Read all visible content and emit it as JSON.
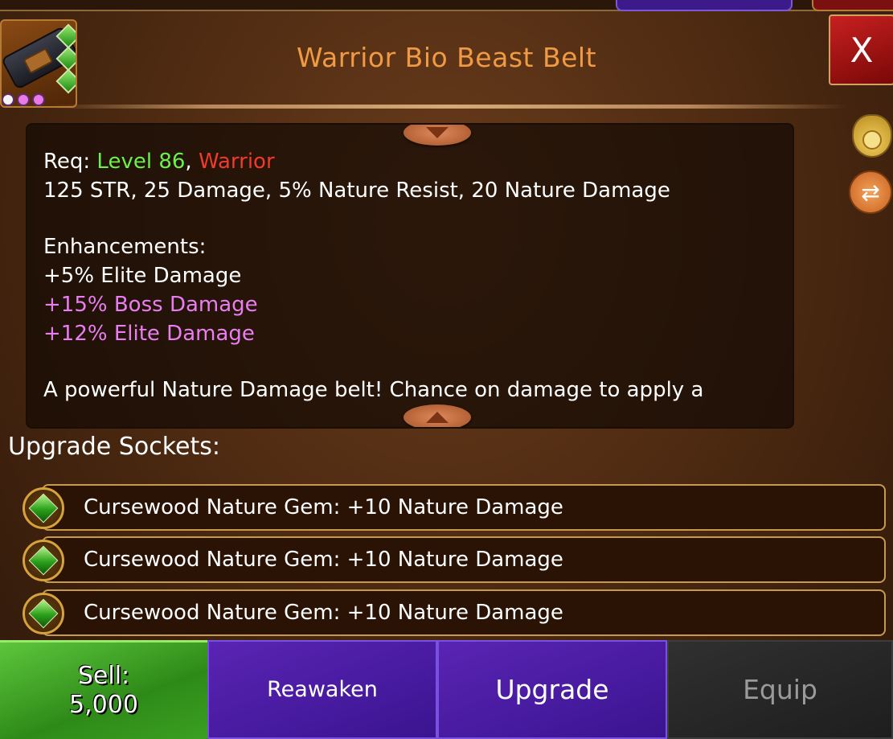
{
  "title": "Warrior Bio Beast Belt",
  "close_label": "X",
  "description": {
    "req_label": "Req: ",
    "req_level": "Level 86",
    "req_separator": ", ",
    "req_class": "Warrior",
    "stats": "125 STR, 25 Damage, 5% Nature Resist, 20 Nature Damage",
    "enhancements_label": "Enhancements:",
    "enhancements": [
      {
        "text": "+5% Elite Damage",
        "color": "#ffffff"
      },
      {
        "text": "+15% Boss Damage",
        "color": "#e87ef0"
      },
      {
        "text": "+12% Elite Damage",
        "color": "#e87ef0"
      }
    ],
    "flavor": "A powerful Nature Damage belt! Chance on damage to apply a"
  },
  "sockets": {
    "title": "Upgrade Sockets:",
    "items": [
      {
        "label": "Cursewood Nature Gem: +10 Nature Damage"
      },
      {
        "label": "Cursewood Nature Gem: +10 Nature Damage"
      },
      {
        "label": "Cursewood Nature Gem: +10 Nature Damage"
      }
    ]
  },
  "actions": {
    "sell_label": "Sell:",
    "sell_price": "5,000",
    "reawaken_label": "Reawaken",
    "upgrade_label": "Upgrade",
    "equip_label": "Equip"
  },
  "icons": {
    "item": "belt-icon",
    "gold": "coin-bag-icon",
    "swap": "swap-icon",
    "gem": "nature-gem-icon"
  },
  "colors": {
    "title": "#f19a44",
    "level": "#6cf04a",
    "class": "#f03a2a",
    "enhancement_rare": "#e87ef0",
    "sell": "#3aa022",
    "purple_button": "#3a1490",
    "equip_disabled": "#9a9a9a"
  }
}
